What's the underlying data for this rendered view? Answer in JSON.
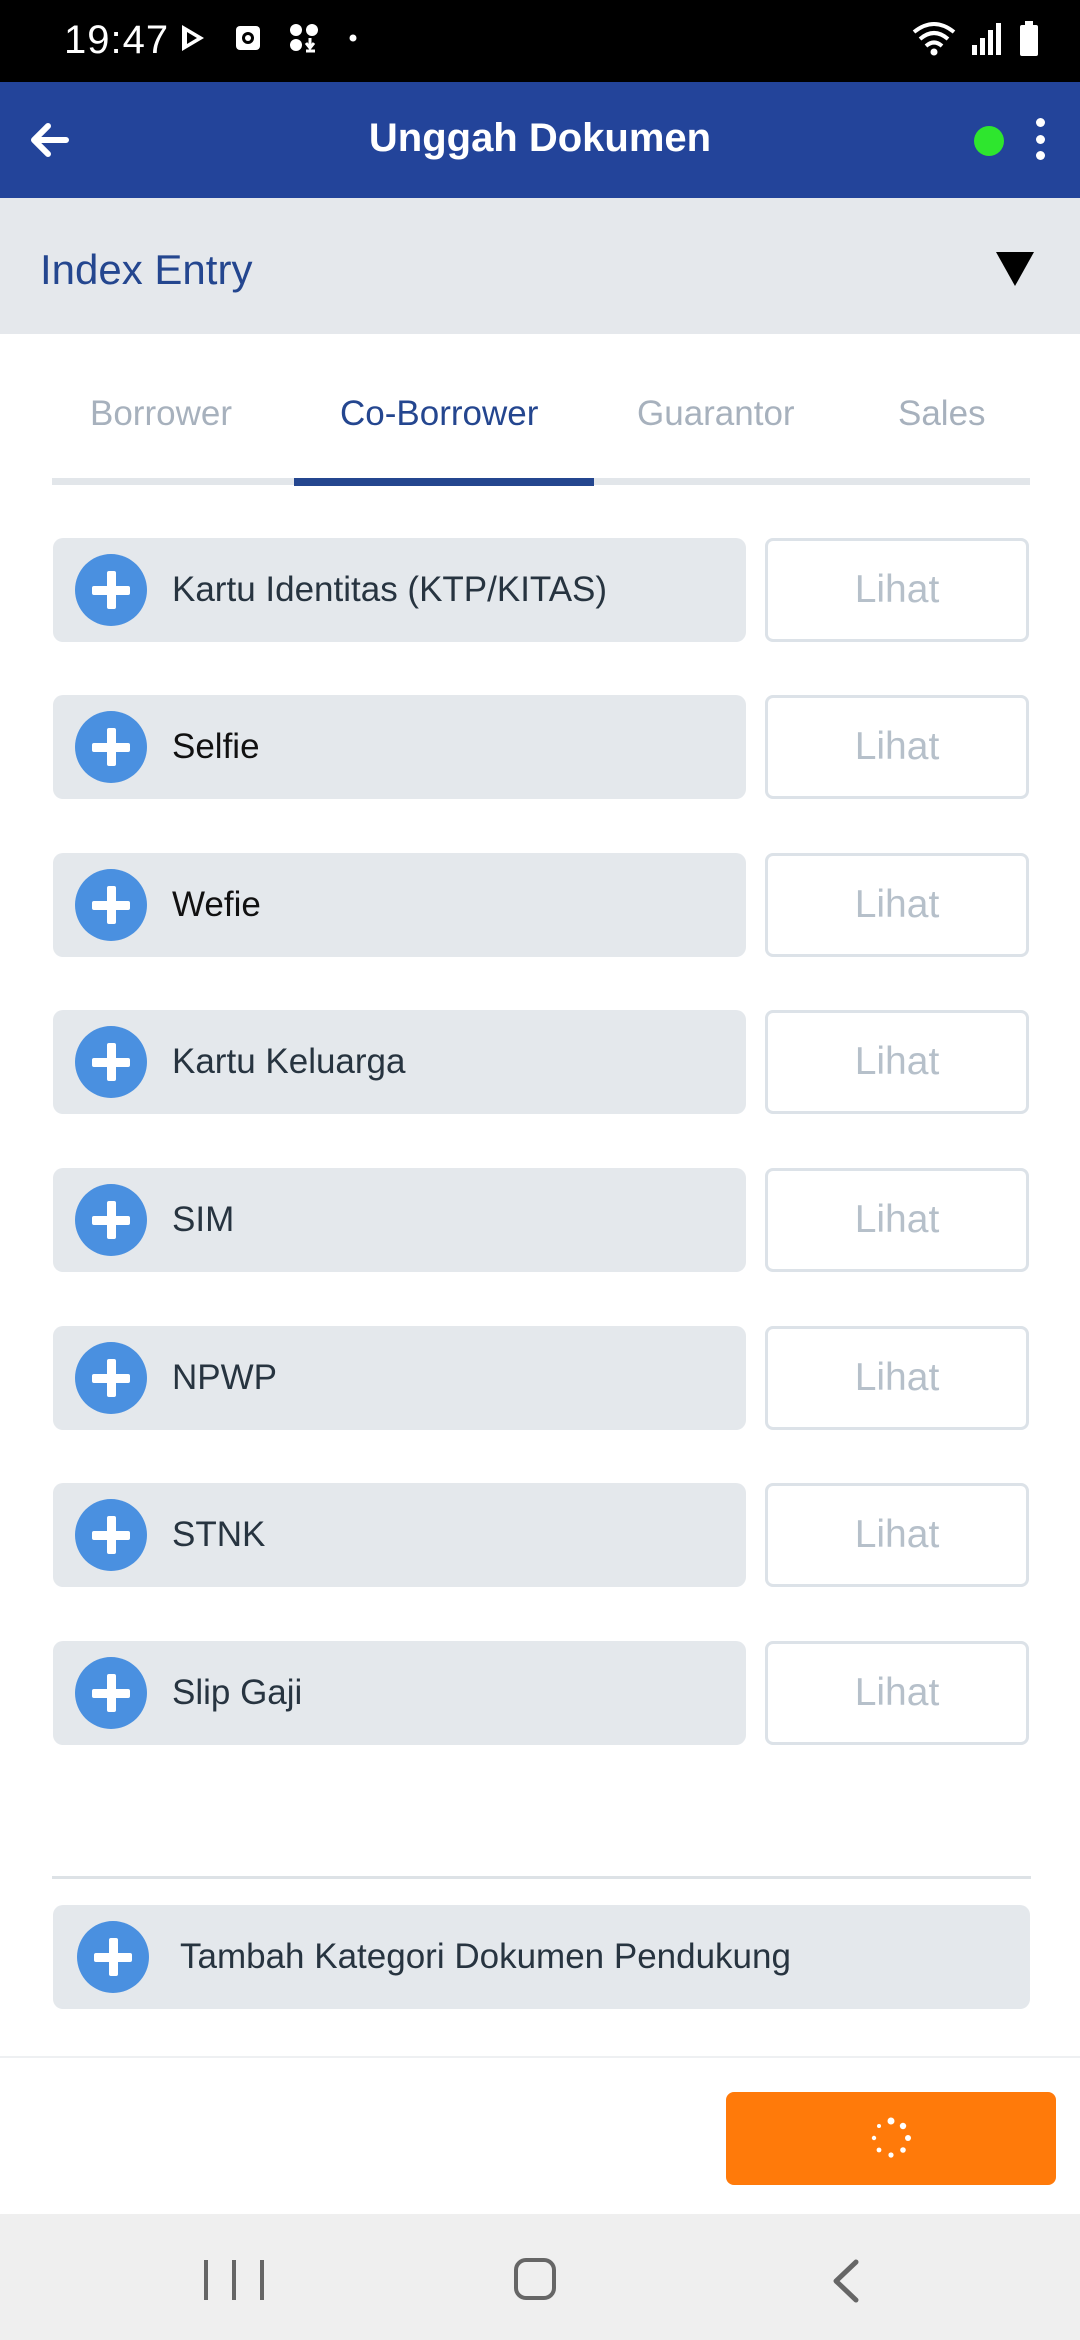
{
  "status_bar": {
    "time": "19:47",
    "left_icons": [
      "play-store-icon",
      "screenshot-icon",
      "download-icon",
      "dot-icon"
    ],
    "right_icons": [
      "wifi-icon",
      "signal-icon",
      "battery-icon"
    ]
  },
  "app_bar": {
    "title": "Unggah Dokumen",
    "back_icon": "arrow-left-icon",
    "status_color": "#2ee62e",
    "menu_icon": "more-vertical-icon"
  },
  "section": {
    "title": "Index Entry",
    "toggle_icon": "triangle-down-icon"
  },
  "tabs": [
    {
      "label": "Borrower",
      "active": false
    },
    {
      "label": "Co-Borrower",
      "active": true
    },
    {
      "label": "Guarantor",
      "active": false
    },
    {
      "label": "Sales",
      "active": false
    }
  ],
  "documents": [
    {
      "label": "Kartu Identitas (KTP/KITAS)",
      "action": "Lihat"
    },
    {
      "label": "Selfie",
      "action": "Lihat"
    },
    {
      "label": "Wefie",
      "action": "Lihat"
    },
    {
      "label": "Kartu Keluarga",
      "action": "Lihat"
    },
    {
      "label": "SIM",
      "action": "Lihat"
    },
    {
      "label": "NPWP",
      "action": "Lihat"
    },
    {
      "label": "STNK",
      "action": "Lihat"
    },
    {
      "label": "Slip Gaji",
      "action": "Lihat"
    }
  ],
  "add_category": {
    "label": "Tambah Kategori Dokumen Pendukung"
  },
  "submit": {
    "state": "loading",
    "icon": "loading-spinner-icon",
    "color": "#ff7a0a"
  },
  "colors": {
    "primary": "#23449a",
    "accent": "#4a90e0",
    "action": "#ff7a0a"
  }
}
